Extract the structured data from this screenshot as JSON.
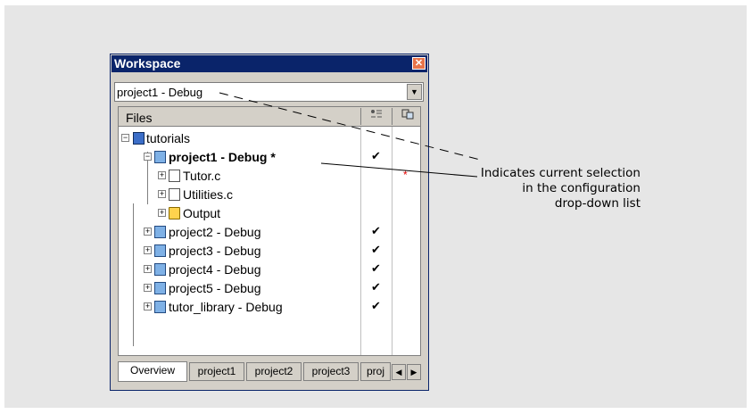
{
  "window": {
    "title": "Workspace",
    "close_glyph": "✕"
  },
  "config_combo": {
    "selected": "project1 - Debug",
    "arrow_glyph": "▼"
  },
  "tree": {
    "header": "Files",
    "rows": [
      {
        "label": "tutorials",
        "checked": "",
        "marker": ""
      },
      {
        "label": "project1 - Debug *",
        "checked": "✔",
        "marker": ""
      },
      {
        "label": "Tutor.c",
        "checked": "",
        "marker": "*"
      },
      {
        "label": "Utilities.c",
        "checked": "",
        "marker": ""
      },
      {
        "label": "Output",
        "checked": "",
        "marker": ""
      },
      {
        "label": "project2 - Debug",
        "checked": "✔",
        "marker": ""
      },
      {
        "label": "project3 - Debug",
        "checked": "✔",
        "marker": ""
      },
      {
        "label": "project4 - Debug",
        "checked": "✔",
        "marker": ""
      },
      {
        "label": "project5 - Debug",
        "checked": "✔",
        "marker": ""
      },
      {
        "label": "tutor_library - Debug",
        "checked": "✔",
        "marker": ""
      }
    ]
  },
  "tabs": [
    "Overview",
    "project1",
    "project2",
    "project3",
    "proj"
  ],
  "tab_scroll": {
    "left": "◀",
    "right": "▶"
  },
  "callout": {
    "line1": "Indicates current selection",
    "line2": "in the configuration",
    "line3": "drop-down list"
  },
  "icons": {
    "close": "close-icon",
    "dropdown": "chevron-down-icon",
    "workspace": "workspace-icon",
    "project": "project-icon",
    "source_file": "source-file-icon",
    "folder": "folder-icon"
  }
}
